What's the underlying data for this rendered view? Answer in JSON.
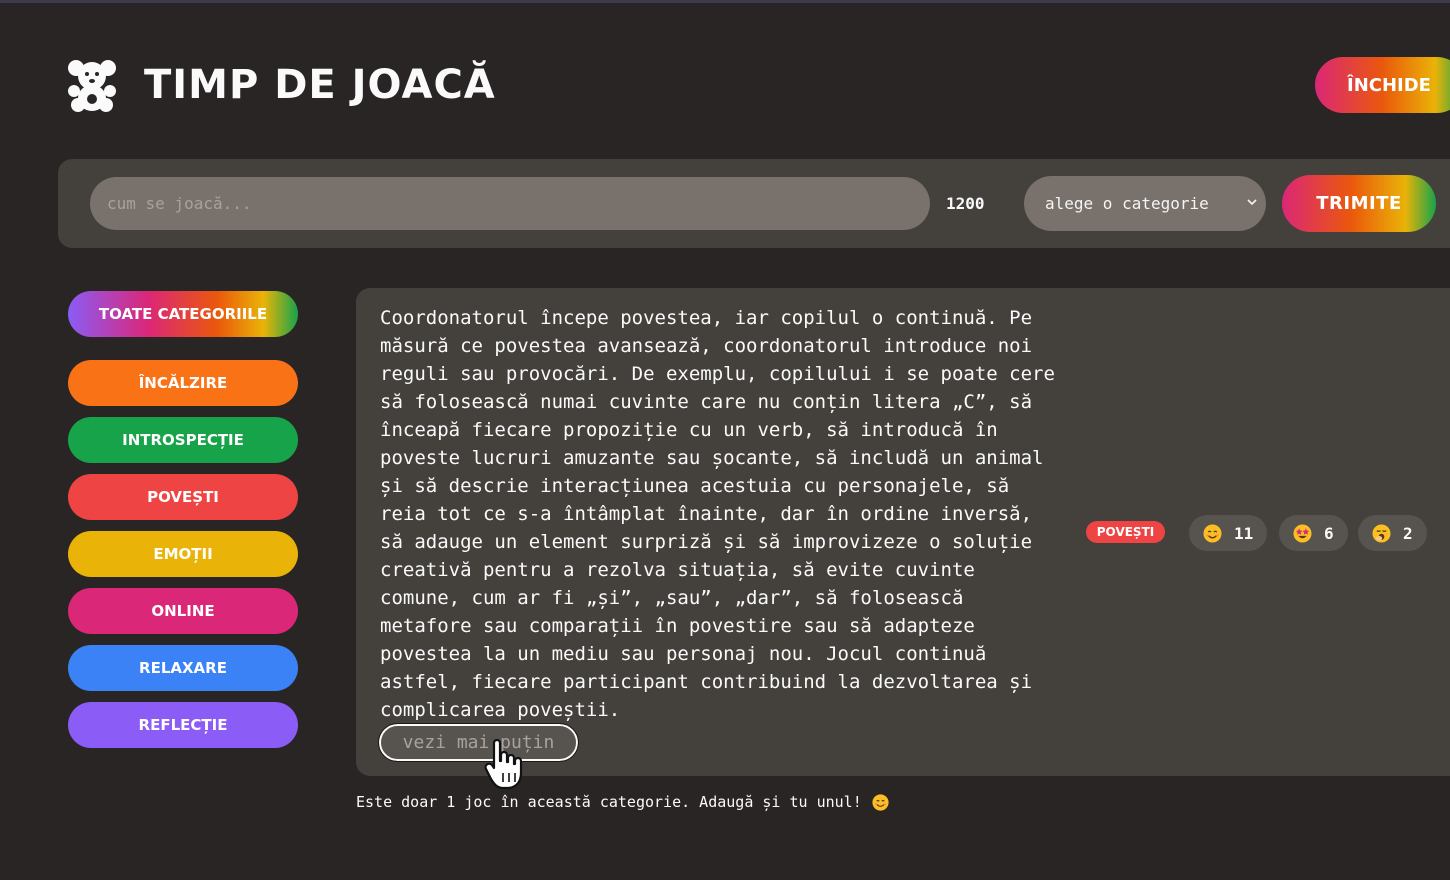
{
  "header": {
    "title": "TIMP DE JOACĂ",
    "close_label": "ÎNCHIDE",
    "logo_icon": "teddy-bear-icon"
  },
  "form": {
    "placeholder": "cum se joacă...",
    "value": "",
    "char_count": "1200",
    "category_selected": "alege o categorie",
    "submit_label": "TRIMITE"
  },
  "sidebar": {
    "items": [
      {
        "label": "TOATE CATEGORIILE",
        "color": "rainbow"
      },
      {
        "label": "ÎNCĂLZIRE",
        "color": "#f97316"
      },
      {
        "label": "INTROSPECȚIE",
        "color": "#16a34a"
      },
      {
        "label": "POVEȘTI",
        "color": "#ef4444"
      },
      {
        "label": "EMOȚII",
        "color": "#eab308"
      },
      {
        "label": "ONLINE",
        "color": "#db2777"
      },
      {
        "label": "RELAXARE",
        "color": "#3b82f6"
      },
      {
        "label": "REFLECȚIE",
        "color": "#8b5cf6"
      }
    ]
  },
  "game": {
    "lines": [
      "Coordonatorul începe povestea, iar copilul o continuă. Pe",
      "măsură ce povestea avansează, coordonatorul introduce noi",
      "reguli sau provocări. De exemplu, copilului i se poate cere",
      "să folosească numai cuvinte care nu conțin litera „C”, să",
      "înceapă fiecare propoziție cu un verb, să introducă în",
      "poveste lucruri amuzante sau șocante, să includă un animal",
      "și să descrie interacțiunea acestuia cu personajele, să",
      "reia tot ce s-a întâmplat înainte, dar în ordine inversă,",
      "să adauge un element surpriză și să improvizeze o soluție",
      "creativă pentru a rezolva situația, să evite cuvinte",
      "comune, cum ar fi „și”, „sau”, „dar”, să folosească",
      "metafore sau comparații în povestire sau să adapteze",
      "povestea la un mediu sau personaj nou. Jocul continuă",
      "astfel, fiecare participant contribuind la dezvoltarea și",
      "complicarea poveștii."
    ],
    "toggle_label": "vezi mai puțin",
    "tag": {
      "label": "POVEȘTI",
      "color": "#ef4444"
    },
    "reactions": [
      {
        "icon": "smiling-face-icon",
        "count": "11"
      },
      {
        "icon": "star-struck-face-icon",
        "count": "6"
      },
      {
        "icon": "yawning-face-icon",
        "count": "2"
      }
    ]
  },
  "footer": {
    "note": "Este doar 1 joc în această categorie. Adaugă și tu unul!",
    "icon": "smiling-face-icon"
  }
}
